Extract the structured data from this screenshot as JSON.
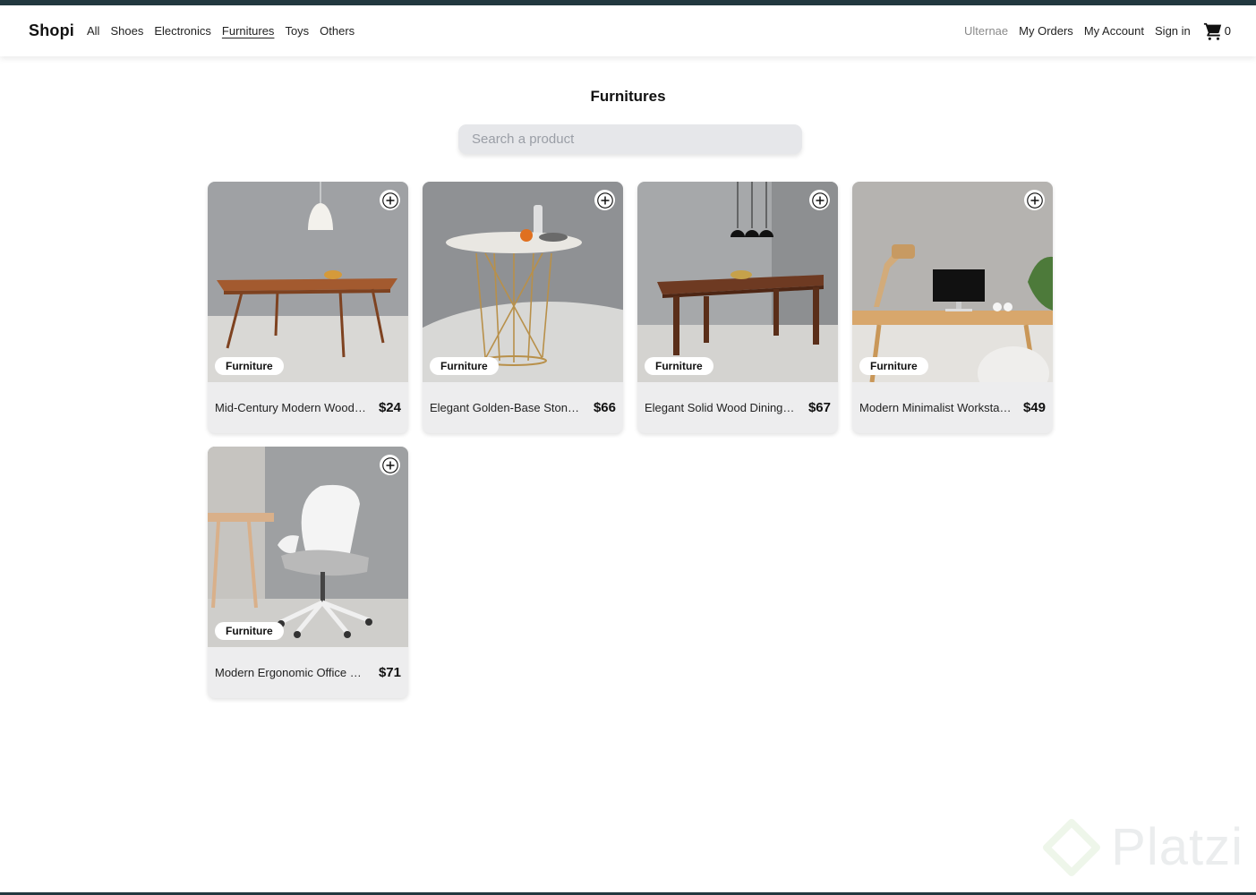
{
  "navbar": {
    "brand": "Shopi",
    "categories": [
      "All",
      "Shoes",
      "Electronics",
      "Furnitures",
      "Toys",
      "Others"
    ],
    "active_category": "Furnitures",
    "user_email": "Ulternae",
    "my_orders": "My Orders",
    "my_account": "My Account",
    "sign_in": "Sign in",
    "cart_count": "0"
  },
  "page": {
    "title": "Furnitures",
    "search_placeholder": "Search a product"
  },
  "products": [
    {
      "title": "Mid-Century Modern Wooden Dining Table",
      "price": "$24",
      "category": "Furniture"
    },
    {
      "title": "Elegant Golden-Base Stone Top Dining Table",
      "price": "$66",
      "category": "Furniture"
    },
    {
      "title": "Elegant Solid Wood Dining Table",
      "price": "$67",
      "category": "Furniture"
    },
    {
      "title": "Modern Minimalist Workstation Setup",
      "price": "$49",
      "category": "Furniture"
    },
    {
      "title": "Modern Ergonomic Office Chair",
      "price": "$71",
      "category": "Furniture"
    }
  ],
  "watermark": {
    "text": "Platzi"
  },
  "colors": {
    "top_bar": "#22383f",
    "card_bg": "#ededee",
    "search_bg": "#e6e7ea"
  }
}
